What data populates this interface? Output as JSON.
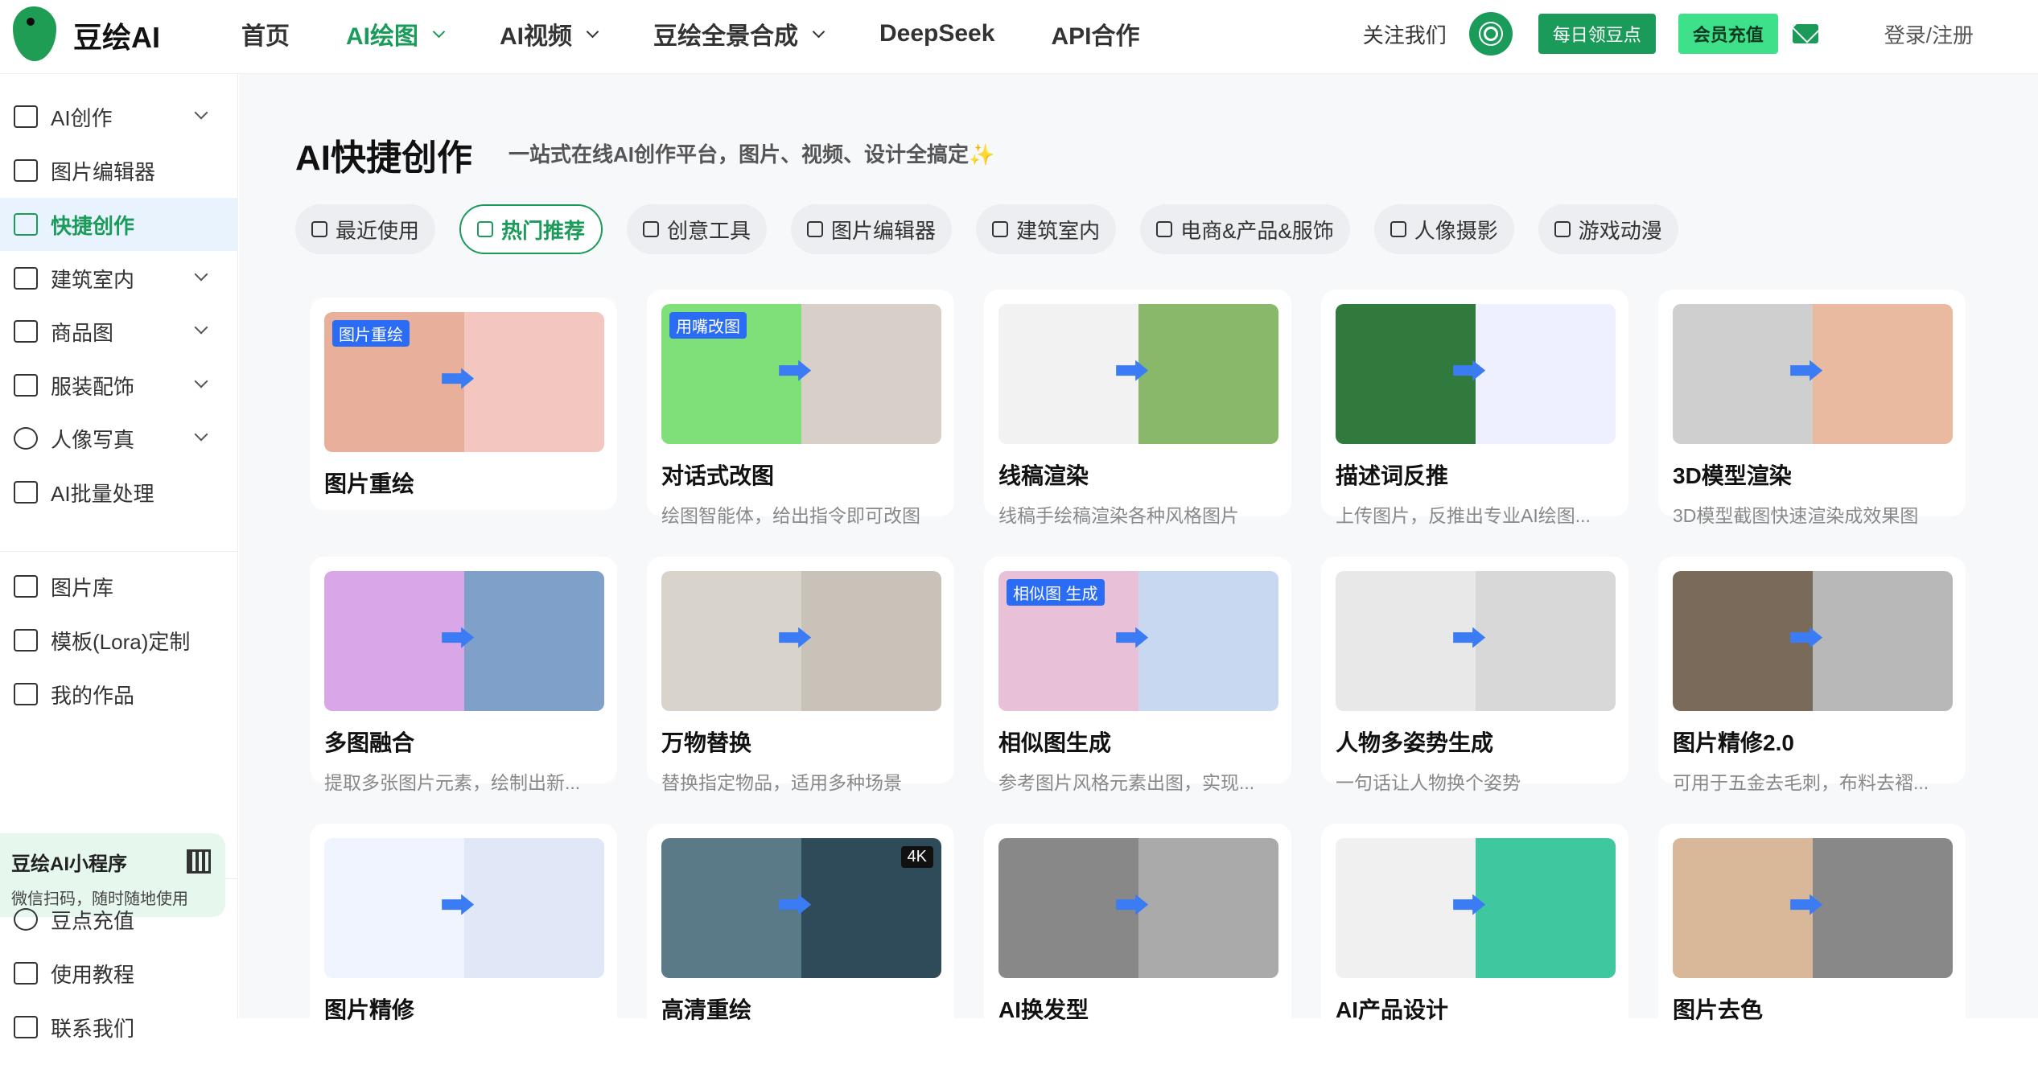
{
  "app": {
    "name": "豆绘AI"
  },
  "nav": {
    "items": [
      {
        "label": "首页",
        "dropdown": false,
        "active": false
      },
      {
        "label": "AI绘图",
        "dropdown": true,
        "active": true
      },
      {
        "label": "AI视频",
        "dropdown": true,
        "active": false
      },
      {
        "label": "豆绘全景合成",
        "dropdown": true,
        "active": false
      },
      {
        "label": "DeepSeek",
        "dropdown": false,
        "active": false
      },
      {
        "label": "API合作",
        "dropdown": false,
        "active": false
      }
    ]
  },
  "header": {
    "follow": "关注我们",
    "daily": "每日领豆点",
    "member": "会员充值",
    "login": "登录/注册",
    "accent": "#1a9b5a"
  },
  "sidebar": {
    "items": [
      {
        "label": "AI创作",
        "icon": "ai-create-icon",
        "chevron": true
      },
      {
        "label": "图片编辑器",
        "icon": "image-edit-icon",
        "chevron": false
      },
      {
        "label": "快捷创作",
        "icon": "cube-icon",
        "chevron": false,
        "active": true
      },
      {
        "label": "建筑室内",
        "icon": "building-icon",
        "chevron": true
      },
      {
        "label": "商品图",
        "icon": "bag-icon",
        "chevron": true
      },
      {
        "label": "服装配饰",
        "icon": "shirt-icon",
        "chevron": true
      },
      {
        "label": "人像写真",
        "icon": "camera-icon",
        "chevron": true
      },
      {
        "label": "AI批量处理",
        "icon": "zip-icon",
        "chevron": false
      },
      {
        "label": "图片库",
        "icon": "gallery-icon",
        "chevron": false
      },
      {
        "label": "模板(Lora)定制",
        "icon": "template-icon",
        "chevron": false
      },
      {
        "label": "我的作品",
        "icon": "document-icon",
        "chevron": false
      },
      {
        "label": "豆点充值",
        "icon": "diamond-icon",
        "chevron": false
      },
      {
        "label": "使用教程",
        "icon": "tutorial-icon",
        "chevron": false
      },
      {
        "label": "联系我们",
        "icon": "contact-icon",
        "chevron": false
      }
    ],
    "mini_program": {
      "title": "豆绘AI小程序",
      "subtitle": "微信扫码，随时随地使用"
    }
  },
  "page": {
    "title": "AI快捷创作",
    "subtitle": "一站式在线AI创作平台，图片、视频、设计全搞定✨"
  },
  "tabs": [
    {
      "label": "最近使用",
      "icon": "clock-icon"
    },
    {
      "label": "热门推荐",
      "icon": "thumbs-up-icon",
      "active": true
    },
    {
      "label": "创意工具",
      "icon": "cube-icon"
    },
    {
      "label": "图片编辑器",
      "icon": "image-edit-icon"
    },
    {
      "label": "建筑室内",
      "icon": "building-icon"
    },
    {
      "label": "电商&产品&服饰",
      "icon": "bag-icon"
    },
    {
      "label": "人像摄影",
      "icon": "camera-icon"
    },
    {
      "label": "游戏动漫",
      "icon": "box-icon"
    }
  ],
  "cards": [
    {
      "title": "图片重绘",
      "desc": "",
      "badge": "图片重绘",
      "c1": "#e8b09a",
      "c2": "#f3c7c0"
    },
    {
      "title": "对话式改图",
      "desc": "绘图智能体，给出指令即可改图",
      "badge": "用嘴改图",
      "c1": "#7fe07a",
      "c2": "#d8d0c8"
    },
    {
      "title": "线稿渲染",
      "desc": "线稿手绘稿渲染各种风格图片",
      "badge": "",
      "c1": "#f2f2f2",
      "c2": "#8ab86a"
    },
    {
      "title": "描述词反推",
      "desc": "上传图片，反推出专业AI绘图...",
      "badge": "",
      "c1": "#2f7a3c",
      "c2": "#eef0ff"
    },
    {
      "title": "3D模型渲染",
      "desc": "3D模型截图快速渲染成效果图",
      "badge": "",
      "c1": "#cfcfcf",
      "c2": "#e9b9a0"
    },
    {
      "title": "多图融合",
      "desc": "提取多张图片元素，绘制出新...",
      "badge": "",
      "c1": "#d9a7e8",
      "c2": "#7fa0c8"
    },
    {
      "title": "万物替换",
      "desc": "替换指定物品，适用多种场景",
      "badge": "",
      "c1": "#d8d4cc",
      "c2": "#c8c2b8"
    },
    {
      "title": "相似图生成",
      "desc": "参考图片风格元素出图，实现...",
      "badge": "相似图 生成",
      "c1": "#e8c0d8",
      "c2": "#c8d8f0"
    },
    {
      "title": "人物多姿势生成",
      "desc": "一句话让人物换个姿势",
      "badge": "",
      "c1": "#e8e8e8",
      "c2": "#d8d8d8"
    },
    {
      "title": "图片精修2.0",
      "desc": "可用于五金去毛刺，布料去褶...",
      "badge": "",
      "c1": "#7a6a5a",
      "c2": "#b8b8b8"
    },
    {
      "title": "图片精修",
      "desc": "",
      "badge": "",
      "c1": "#f0f4ff",
      "c2": "#e0e8f8"
    },
    {
      "title": "高清重绘",
      "desc": "",
      "badge": "4K",
      "c1": "#5a7a88",
      "c2": "#2f4a58"
    },
    {
      "title": "AI换发型",
      "desc": "",
      "badge": "",
      "c1": "#888",
      "c2": "#aaa"
    },
    {
      "title": "AI产品设计",
      "desc": "",
      "badge": "",
      "c1": "#f0f0f0",
      "c2": "#3fc8a0"
    },
    {
      "title": "图片去色",
      "desc": "",
      "badge": "",
      "c1": "#d8b898",
      "c2": "#888"
    }
  ]
}
